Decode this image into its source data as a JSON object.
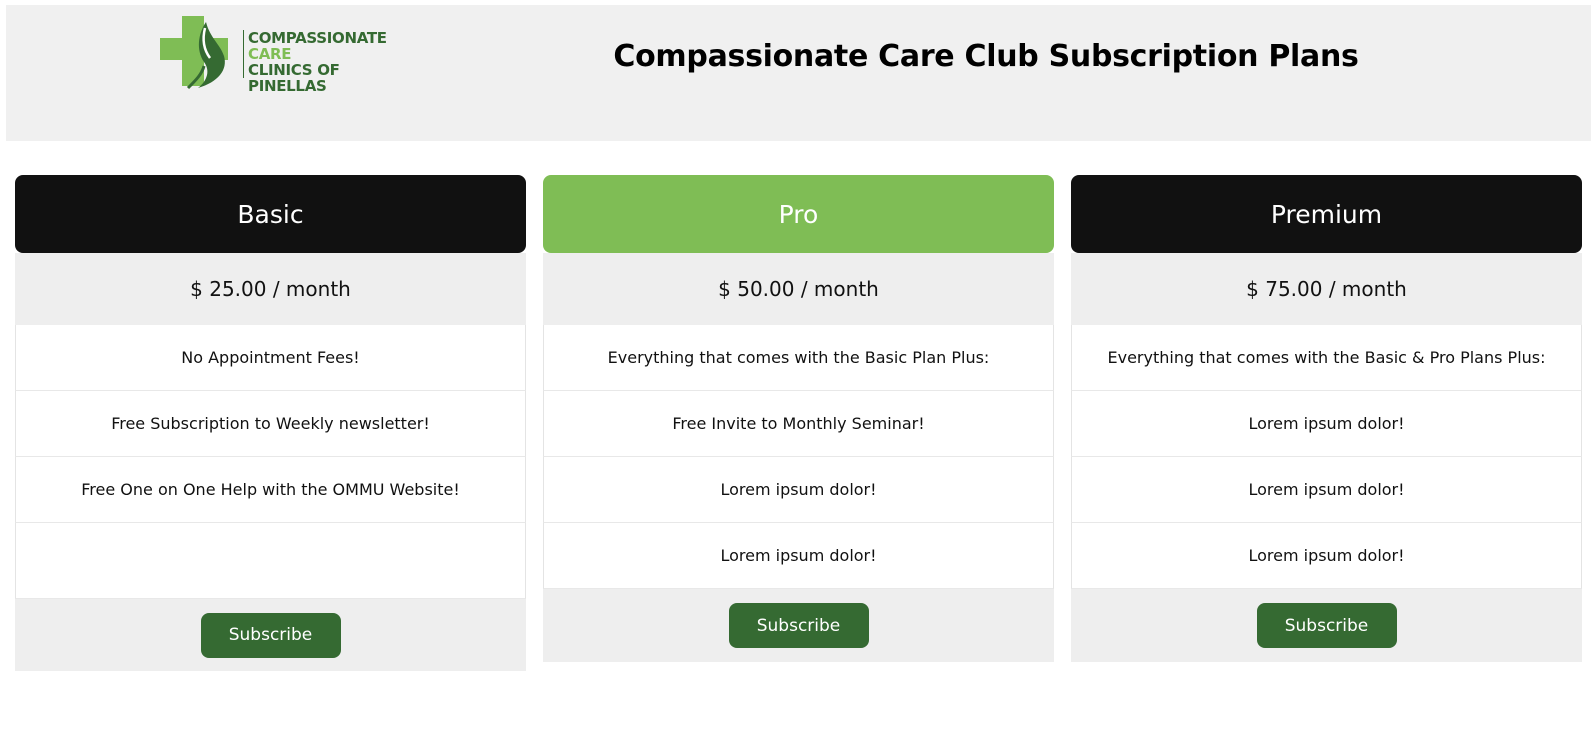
{
  "header": {
    "logo": {
      "line1": "COMPASSIONATE",
      "line2": "CARE",
      "line3": "CLINICS OF PINELLAS"
    },
    "title": "Compassionate Care Club Subscription Plans"
  },
  "colors": {
    "dark_header": "#111111",
    "green_header": "#7fbd55",
    "button": "#356a32"
  },
  "plans": [
    {
      "name": "Basic",
      "price": "$ 25.00 / month",
      "features": [
        "No Appointment Fees!",
        "Free Subscription to Weekly newsletter!",
        "Free One on One Help with the OMMU Website!"
      ],
      "button": "Subscribe"
    },
    {
      "name": "Pro",
      "price": "$ 50.00 / month",
      "features": [
        "Everything that comes with the Basic Plan Plus:",
        "Free Invite to Monthly Seminar!",
        "Lorem ipsum dolor!",
        "Lorem ipsum dolor!"
      ],
      "button": "Subscribe"
    },
    {
      "name": "Premium",
      "price": "$ 75.00 / month",
      "features": [
        "Everything that comes with the Basic & Pro Plans Plus:",
        "Lorem ipsum dolor!",
        "Lorem ipsum dolor!",
        "Lorem ipsum dolor!"
      ],
      "button": "Subscribe"
    }
  ]
}
